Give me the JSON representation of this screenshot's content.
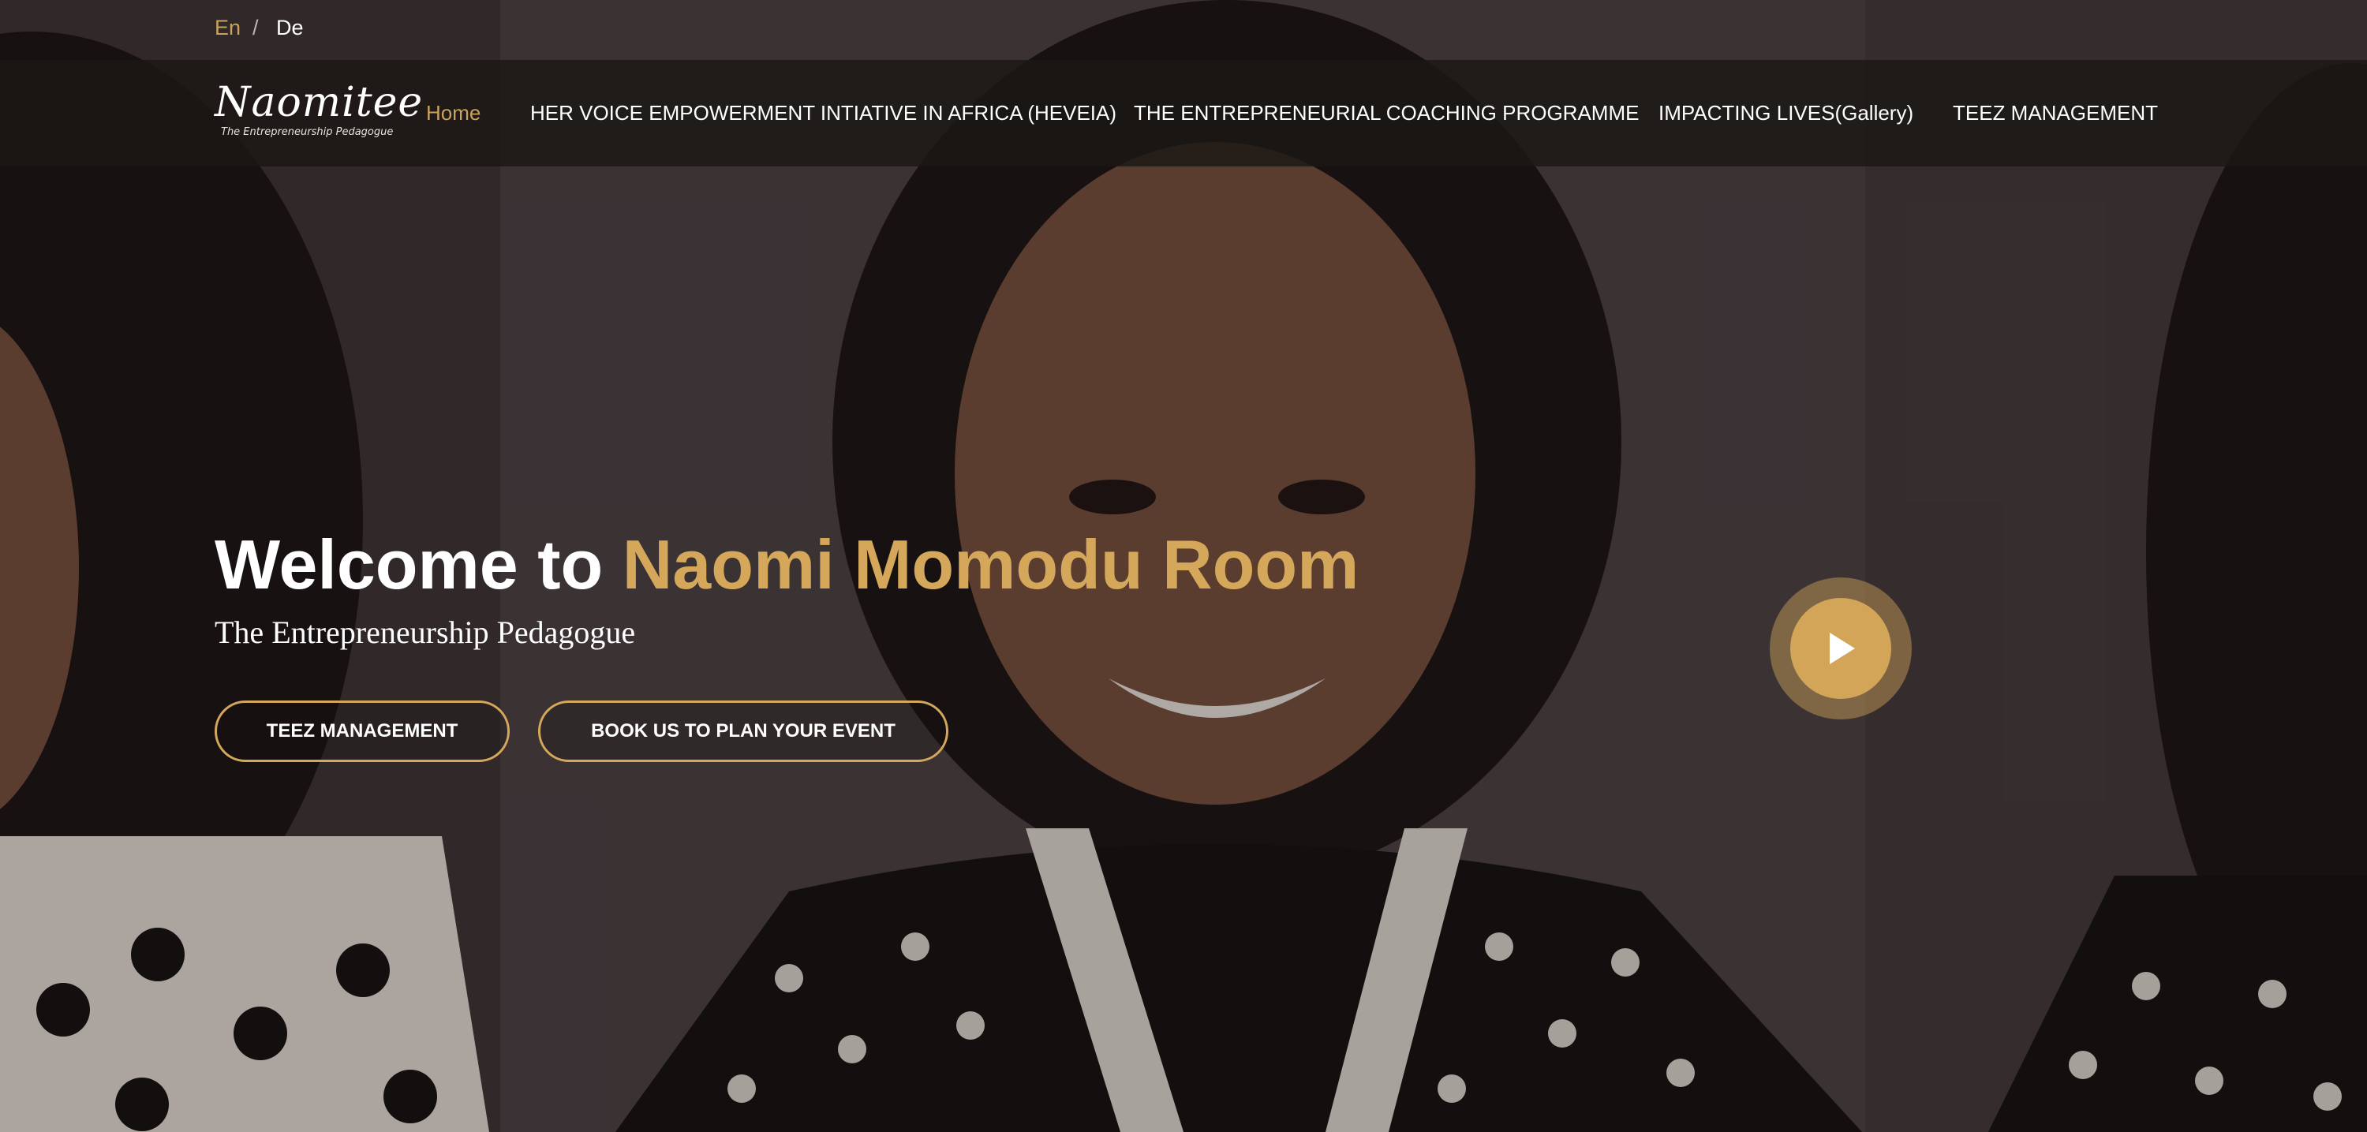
{
  "language_bar": {
    "english": "En",
    "separator": "/",
    "german": "De"
  },
  "logo": {
    "script_text": "Naomitee",
    "tagline": "The Entrepreneurship Pedagogue"
  },
  "nav": {
    "items": [
      {
        "label": "Home",
        "active": true
      },
      {
        "label": "HER VOICE EMPOWERMENT INTIATIVE IN AFRICA (HEVEIA)",
        "active": false
      },
      {
        "label": "THE ENTREPRENEURIAL COACHING PROGRAMME",
        "active": false
      },
      {
        "label": "IMPACTING LIVES(Gallery)",
        "active": false
      },
      {
        "label": "TEEZ MANAGEMENT",
        "active": false
      }
    ]
  },
  "hero": {
    "title_prefix": "Welcome to ",
    "title_highlight": "Naomi Momodu Room",
    "subtitle": "The Entrepreneurship Pedagogue",
    "buttons": [
      {
        "label": "TEEZ MANAGEMENT"
      },
      {
        "label": "BOOK US TO PLAN YOUR EVENT"
      }
    ],
    "play_button_icon": "play-icon"
  },
  "colors": {
    "accent_gold": "#d4a75a",
    "nav_background": "#1c1816",
    "text_white": "#ffffff"
  }
}
